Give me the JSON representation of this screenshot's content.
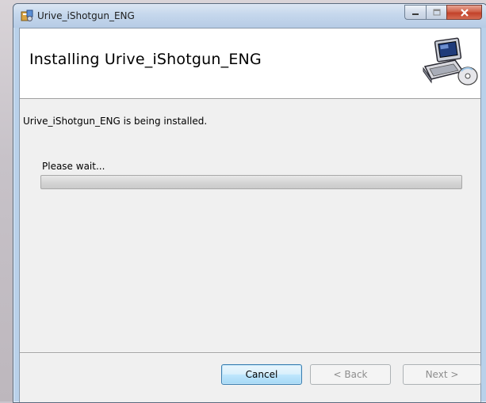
{
  "window": {
    "title": "Urive_iShotgun_ENG"
  },
  "header": {
    "title": "Installing Urive_iShotgun_ENG"
  },
  "body": {
    "status": "Urive_iShotgun_ENG is being installed.",
    "wait_label": "Please wait...",
    "progress_percent": 0
  },
  "buttons": {
    "cancel": "Cancel",
    "back": "< Back",
    "next": "Next >"
  },
  "icons": {
    "app": "installer-icon",
    "header": "computer-disc-icon"
  }
}
